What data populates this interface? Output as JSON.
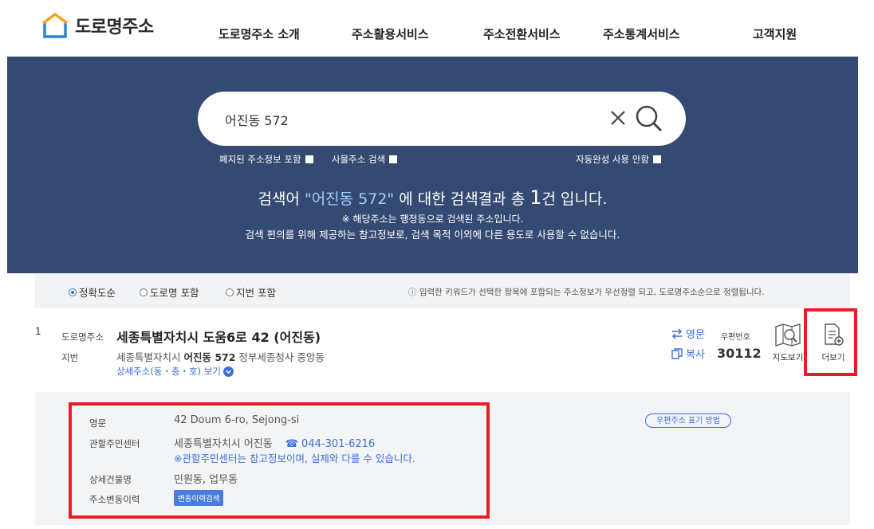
{
  "header": {
    "logo_text": "도로명주소",
    "nav": [
      "도로명주소 소개",
      "주소활용서비스",
      "주소전환서비스",
      "주소통계서비스",
      "고객지원"
    ]
  },
  "search": {
    "value": "어진동 572",
    "options": {
      "abolished": "폐지된 주소정보 포함",
      "thing": "사물주소 검색",
      "autocomplete_off": "자동완성 사용 안함"
    }
  },
  "result_summary": {
    "prefix": "검색어 ",
    "keyword": "\"어진동 572\"",
    "middle": " 에 대한 검색결과 총 ",
    "count": "1",
    "suffix": "건 입니다.",
    "note1": "※ 해당주소는 행정동으로 검색된 주소입니다.",
    "note2": "검색 편의를 위해 제공하는 참고정보로, 검색 목적 이외에 다른 용도로 사용할 수 없습니다."
  },
  "filters": {
    "options": [
      "정확도순",
      "도로명 포함",
      "지번 포함"
    ],
    "selected": "정확도순",
    "hint": "ⓘ 입력한 키워드가 선택한 항목에 포함되는 주소정보가 우선정렬 되고, 도로명주소순으로 정렬됩니다."
  },
  "result": {
    "number": "1",
    "road_label": "도로명주소",
    "road_address": "세종특별자치시 도움6로 42 (어진동)",
    "jibun_label": "지번",
    "jibun_pre": "세종특별자치시 ",
    "jibun_bold": "어진동 572",
    "jibun_post": " 정부세종청사 중앙동",
    "detail_link": "상세주소(동・층・호) 보기",
    "english_btn": "영문",
    "copy_btn": "복사",
    "zip_label": "우편번호",
    "zip_code": "30112",
    "map_btn": "지도보기",
    "more_btn": "더보기"
  },
  "detail": {
    "english_label": "영문",
    "english_value": "42 Doum 6-ro, Sejong-si",
    "center_label": "관할주민센터",
    "center_value": "세종특별자치시 어진동",
    "center_phone": "☎ 044-301-6216",
    "center_note": "※관할주민센터는 참고정보이며, 실제와 다를 수 있습니다.",
    "building_label": "상세건물명",
    "building_value": "민원동, 업무동",
    "history_label": "주소변동이력",
    "history_btn": "변동이력검색",
    "zip_method_btn": "우편주소 표기 방법"
  },
  "colors": {
    "hero_bg": "#344a73",
    "accent_blue": "#3a6fd8",
    "highlight_red": "#e51d26",
    "logo_blue": "#2f80d1",
    "logo_orange": "#f4a21b"
  }
}
